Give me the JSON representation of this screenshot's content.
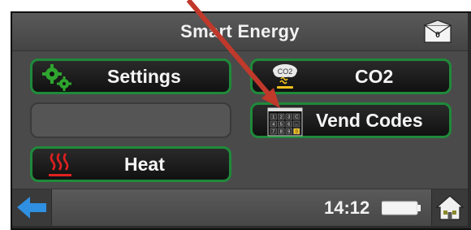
{
  "header": {
    "title": "Smart Energy",
    "message_count": "0"
  },
  "tiles": [
    {
      "label": "Settings",
      "icon": "gears-icon"
    },
    {
      "label": "CO2",
      "icon": "co2-cloud-icon",
      "icon_text": "CO2"
    },
    {
      "label": "",
      "icon": ""
    },
    {
      "label": "Vend Codes",
      "icon": "keypad-icon",
      "keypad_keys": [
        "1",
        "2",
        "3",
        "C",
        "4",
        "5",
        "6",
        "←",
        "7",
        "8",
        "9",
        "0"
      ]
    },
    {
      "label": "Heat",
      "icon": "heat-waves-icon"
    }
  ],
  "status": {
    "time": "14:12"
  },
  "colors": {
    "tile_border": "#1f8a3a",
    "back_arrow": "#2f8fe0",
    "heat_icon": "#e02020",
    "co2_icon": "#f0c020"
  }
}
